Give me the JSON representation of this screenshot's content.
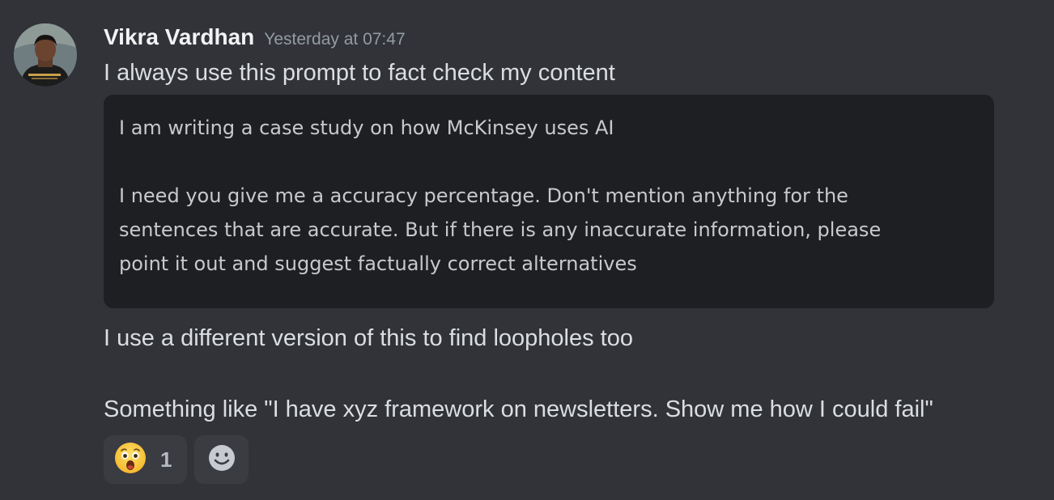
{
  "message": {
    "author": "Vikra Vardhan",
    "timestamp": "Yesterday at 07:47",
    "line1": "I always use this prompt to fact check my content",
    "code_block": {
      "lines": [
        "I am writing a case study on how McKinsey uses AI",
        "",
        "I need you give me a accuracy percentage. Don't mention anything for the",
        "sentences that are accurate. But if there is any inaccurate information, please",
        "point it out and suggest factually correct alternatives"
      ]
    },
    "line2": "I use a different version of this to find loopholes too",
    "line3": "Something like \"I have xyz framework on newsletters. Show me how I could fail\""
  },
  "reactions": [
    {
      "icon": "astonished-face-emoji-icon",
      "count": "1"
    }
  ],
  "add_reaction_icon": "smiley-add-reaction-icon",
  "colors": {
    "background": "#313338",
    "code_background": "#1e1f22",
    "reaction_background": "#3a3c42",
    "username": "#f2f3f5",
    "timestamp": "#949ba4",
    "text": "#dbdee1"
  }
}
